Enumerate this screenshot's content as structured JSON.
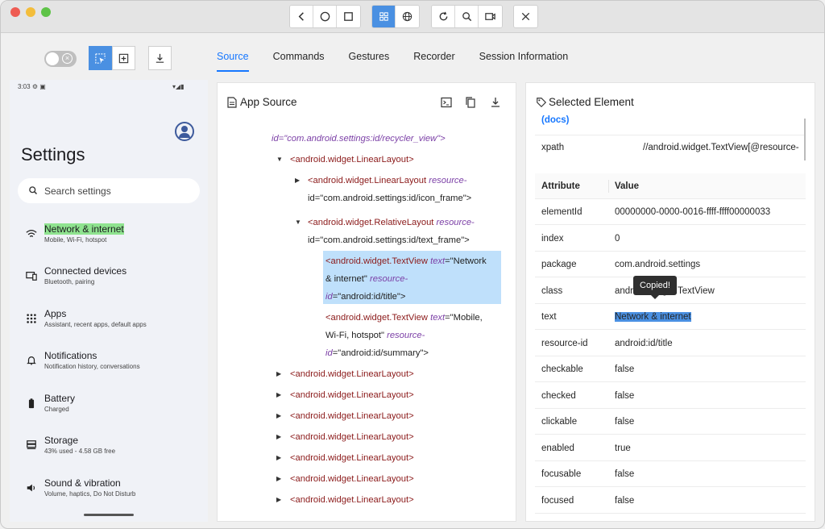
{
  "toolbar": {
    "groups": [
      [
        "back-icon",
        "home-icon",
        "square-icon"
      ],
      [
        "grid-icon",
        "globe-icon"
      ],
      [
        "refresh-icon",
        "search-icon",
        "video-icon"
      ],
      [
        "close-icon"
      ]
    ]
  },
  "tabs": [
    {
      "label": "Source",
      "active": true
    },
    {
      "label": "Commands"
    },
    {
      "label": "Gestures"
    },
    {
      "label": "Recorder"
    },
    {
      "label": "Session Information"
    }
  ],
  "device": {
    "time": "3:03",
    "title": "Settings",
    "search_placeholder": "Search settings",
    "items": [
      {
        "title": "Network & internet",
        "sub": "Mobile, Wi-Fi, hotspot",
        "icon": "wifi-icon"
      },
      {
        "title": "Connected devices",
        "sub": "Bluetooth, pairing",
        "icon": "devices-icon"
      },
      {
        "title": "Apps",
        "sub": "Assistant, recent apps, default apps",
        "icon": "apps-icon"
      },
      {
        "title": "Notifications",
        "sub": "Notification history, conversations",
        "icon": "bell-icon"
      },
      {
        "title": "Battery",
        "sub": "Charged",
        "icon": "battery-icon"
      },
      {
        "title": "Storage",
        "sub": "43% used - 4.58 GB free",
        "icon": "storage-icon"
      },
      {
        "title": "Sound & vibration",
        "sub": "Volume, haptics, Do Not Disturb",
        "icon": "sound-icon"
      }
    ]
  },
  "source": {
    "title": "App Source",
    "lines": {
      "l0": "id=\"com.android.settings:id/recycler_view\">",
      "l1": "<android.widget.LinearLayout>",
      "l2a": "<android.widget.LinearLayout",
      "l2b": "resource-",
      "l2c": "id=\"com.android.settings:id/icon_frame\">",
      "l3a": "<android.widget.RelativeLayout",
      "l3b": "resource-",
      "l3c": "id=\"com.android.settings:id/text_frame\">",
      "l4a": "<android.widget.TextView",
      "l4b": "text",
      "l4c": "=\"Network",
      "l4d": "& internet\"",
      "l4e": "resource-",
      "l4f": "id",
      "l4g": "=\"android:id/title\">",
      "l5a": "<android.widget.TextView",
      "l5b": "text",
      "l5c": "=\"Mobile,",
      "l5d": "Wi-Fi, hotspot\"",
      "l5e": "resource-",
      "l5f": "id",
      "l5g": "=\"android:id/summary\">",
      "ll": "<android.widget.LinearLayout>"
    }
  },
  "selected": {
    "title": "Selected Element",
    "docs": "(docs)",
    "xpath_label": "xpath",
    "xpath_value": "//android.widget.TextView[@resource-",
    "col_attr": "Attribute",
    "col_value": "Value",
    "tooltip": "Copied!",
    "rows": [
      {
        "k": "elementId",
        "v": "00000000-0000-0016-ffff-ffff00000033"
      },
      {
        "k": "index",
        "v": "0"
      },
      {
        "k": "package",
        "v": "com.android.settings"
      },
      {
        "k": "class",
        "v": "android.widget.TextView"
      },
      {
        "k": "text",
        "v": "Network & internet"
      },
      {
        "k": "resource-id",
        "v": "android:id/title"
      },
      {
        "k": "checkable",
        "v": "false"
      },
      {
        "k": "checked",
        "v": "false"
      },
      {
        "k": "clickable",
        "v": "false"
      },
      {
        "k": "enabled",
        "v": "true"
      },
      {
        "k": "focusable",
        "v": "false"
      },
      {
        "k": "focused",
        "v": "false"
      }
    ]
  }
}
